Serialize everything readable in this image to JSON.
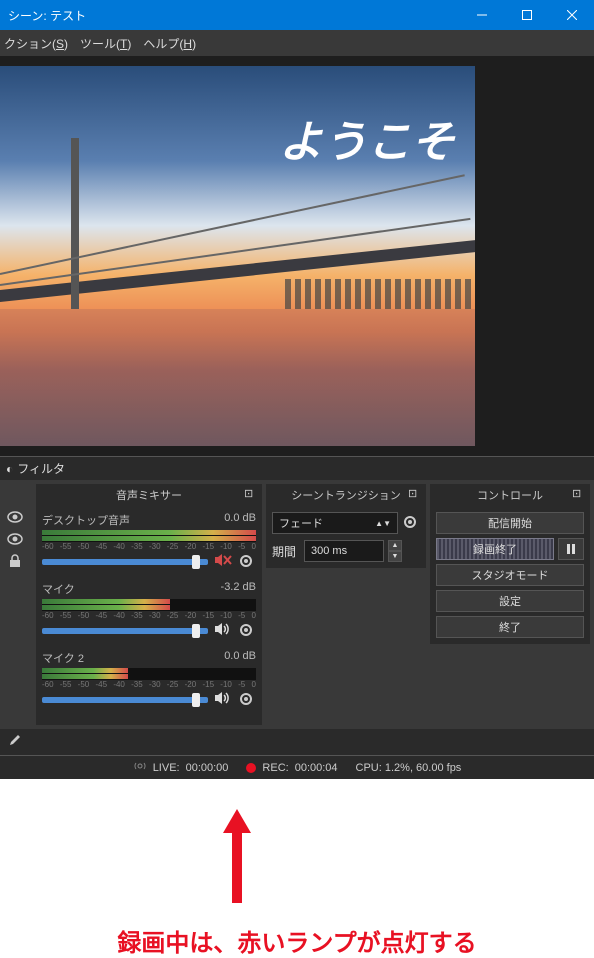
{
  "titlebar": {
    "title": "シーン: テスト"
  },
  "menubar": {
    "items": [
      {
        "label": "クション",
        "accel": "S"
      },
      {
        "label": "ツール",
        "accel": "T"
      },
      {
        "label": "ヘルプ",
        "accel": "H"
      }
    ]
  },
  "preview": {
    "overlay_text": "ようこそ"
  },
  "filter_tab": "フィルタ",
  "mixer": {
    "title": "音声ミキサー",
    "ticks": [
      "-60",
      "-55",
      "-50",
      "-45",
      "-40",
      "-35",
      "-30",
      "-25",
      "-20",
      "-15",
      "-10",
      "-5",
      "0"
    ],
    "tracks": [
      {
        "name": "デスクトップ音声",
        "db": "0.0 dB",
        "muted": true
      },
      {
        "name": "マイク",
        "db": "-3.2 dB",
        "muted": false
      },
      {
        "name": "マイク 2",
        "db": "0.0 dB",
        "muted": false
      }
    ]
  },
  "transitions": {
    "title": "シーントランジション",
    "selected": "フェード",
    "duration_label": "期間",
    "duration_value": "300 ms"
  },
  "controls": {
    "title": "コントロール",
    "start_stream": "配信開始",
    "stop_record": "録画終了",
    "studio_mode": "スタジオモード",
    "settings": "設定",
    "exit": "終了"
  },
  "status": {
    "live_label": "LIVE:",
    "live_time": "00:00:00",
    "rec_label": "REC:",
    "rec_time": "00:00:04",
    "cpu": "CPU: 1.2%, 60.00 fps"
  },
  "annotation": "録画中は、赤いランプが点灯する"
}
